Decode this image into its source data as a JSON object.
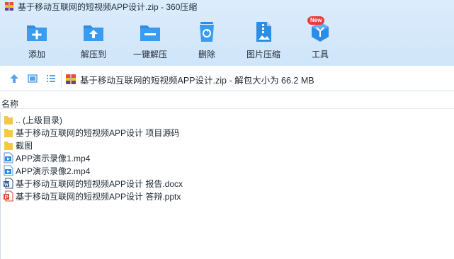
{
  "window": {
    "title": "基于移动互联网的短视频APP设计.zip - 360压缩"
  },
  "toolbar": {
    "items": [
      {
        "label": "添加",
        "icon": "add-icon"
      },
      {
        "label": "解压到",
        "icon": "extract-to-icon"
      },
      {
        "label": "一键解压",
        "icon": "one-click-extract-icon"
      },
      {
        "label": "删除",
        "icon": "recycle-bin-icon"
      },
      {
        "label": "图片压缩",
        "icon": "image-compress-icon"
      },
      {
        "label": "工具",
        "icon": "tools-cube-icon",
        "badge": "New"
      }
    ]
  },
  "address": {
    "path": "基于移动互联网的短视频APP设计.zip - 解包大小为 66.2 MB"
  },
  "columns": {
    "name": "名称"
  },
  "files": [
    {
      "name": ".. (上级目录)",
      "type": "folder"
    },
    {
      "name": "基于移动互联网的短视频APP设计 项目源码",
      "type": "folder"
    },
    {
      "name": "截图",
      "type": "folder"
    },
    {
      "name": "APP演示录像1.mp4",
      "type": "video"
    },
    {
      "name": "APP演示录像2.mp4",
      "type": "video"
    },
    {
      "name": "基于移动互联网的短视频APP设计 报告.docx",
      "type": "word"
    },
    {
      "name": "基于移动互联网的短视频APP设计 答辩.pptx",
      "type": "powerpoint"
    }
  ],
  "colors": {
    "accent": "#2b8ee6",
    "header_bg": "#d6e9fb",
    "badge": "#ef3b3b",
    "folder": "#f5c84c"
  }
}
